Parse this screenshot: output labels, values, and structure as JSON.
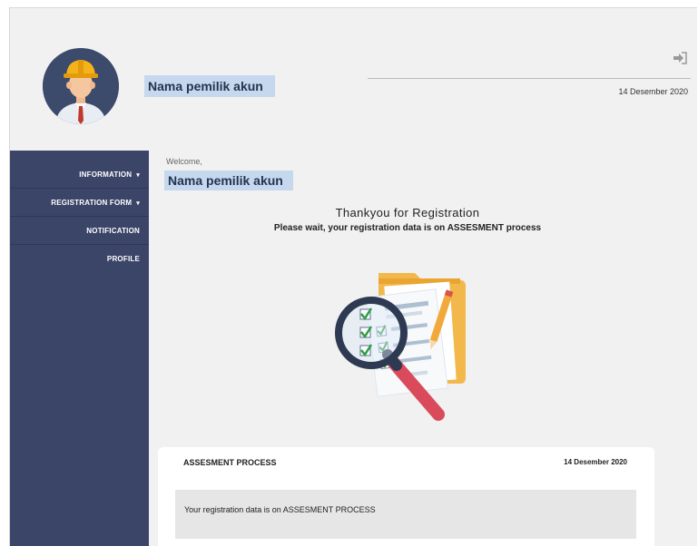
{
  "header": {
    "account_name": "Nama pemilik akun",
    "date": "14 Desember 2020",
    "logout_icon": "logout-icon",
    "avatar_icon": "worker-avatar-icon"
  },
  "sidebar": {
    "items": [
      {
        "label": "INFORMATION",
        "has_caret": true
      },
      {
        "label": "REGISTRATION FORM",
        "has_caret": true
      },
      {
        "label": "NOTIFICATION",
        "has_caret": false
      },
      {
        "label": "PROFILE",
        "has_caret": false
      }
    ],
    "caret": "▾"
  },
  "main": {
    "welcome": "Welcome,",
    "account_name": "Nama pemilik akun",
    "thanks": "Thankyou for Registration",
    "wait_message": "Please wait, your registration data is on ASSESMENT process",
    "illustration_icon": "document-magnifier-icon"
  },
  "card": {
    "title": "ASSESMENT PROCESS",
    "date": "14 Desember 2020",
    "message": "Your registration data is on ASSESMENT PROCESS"
  },
  "colors": {
    "sidebar": "#3b4568",
    "highlight": "#c5d8ee",
    "background": "#f1f1f1"
  }
}
